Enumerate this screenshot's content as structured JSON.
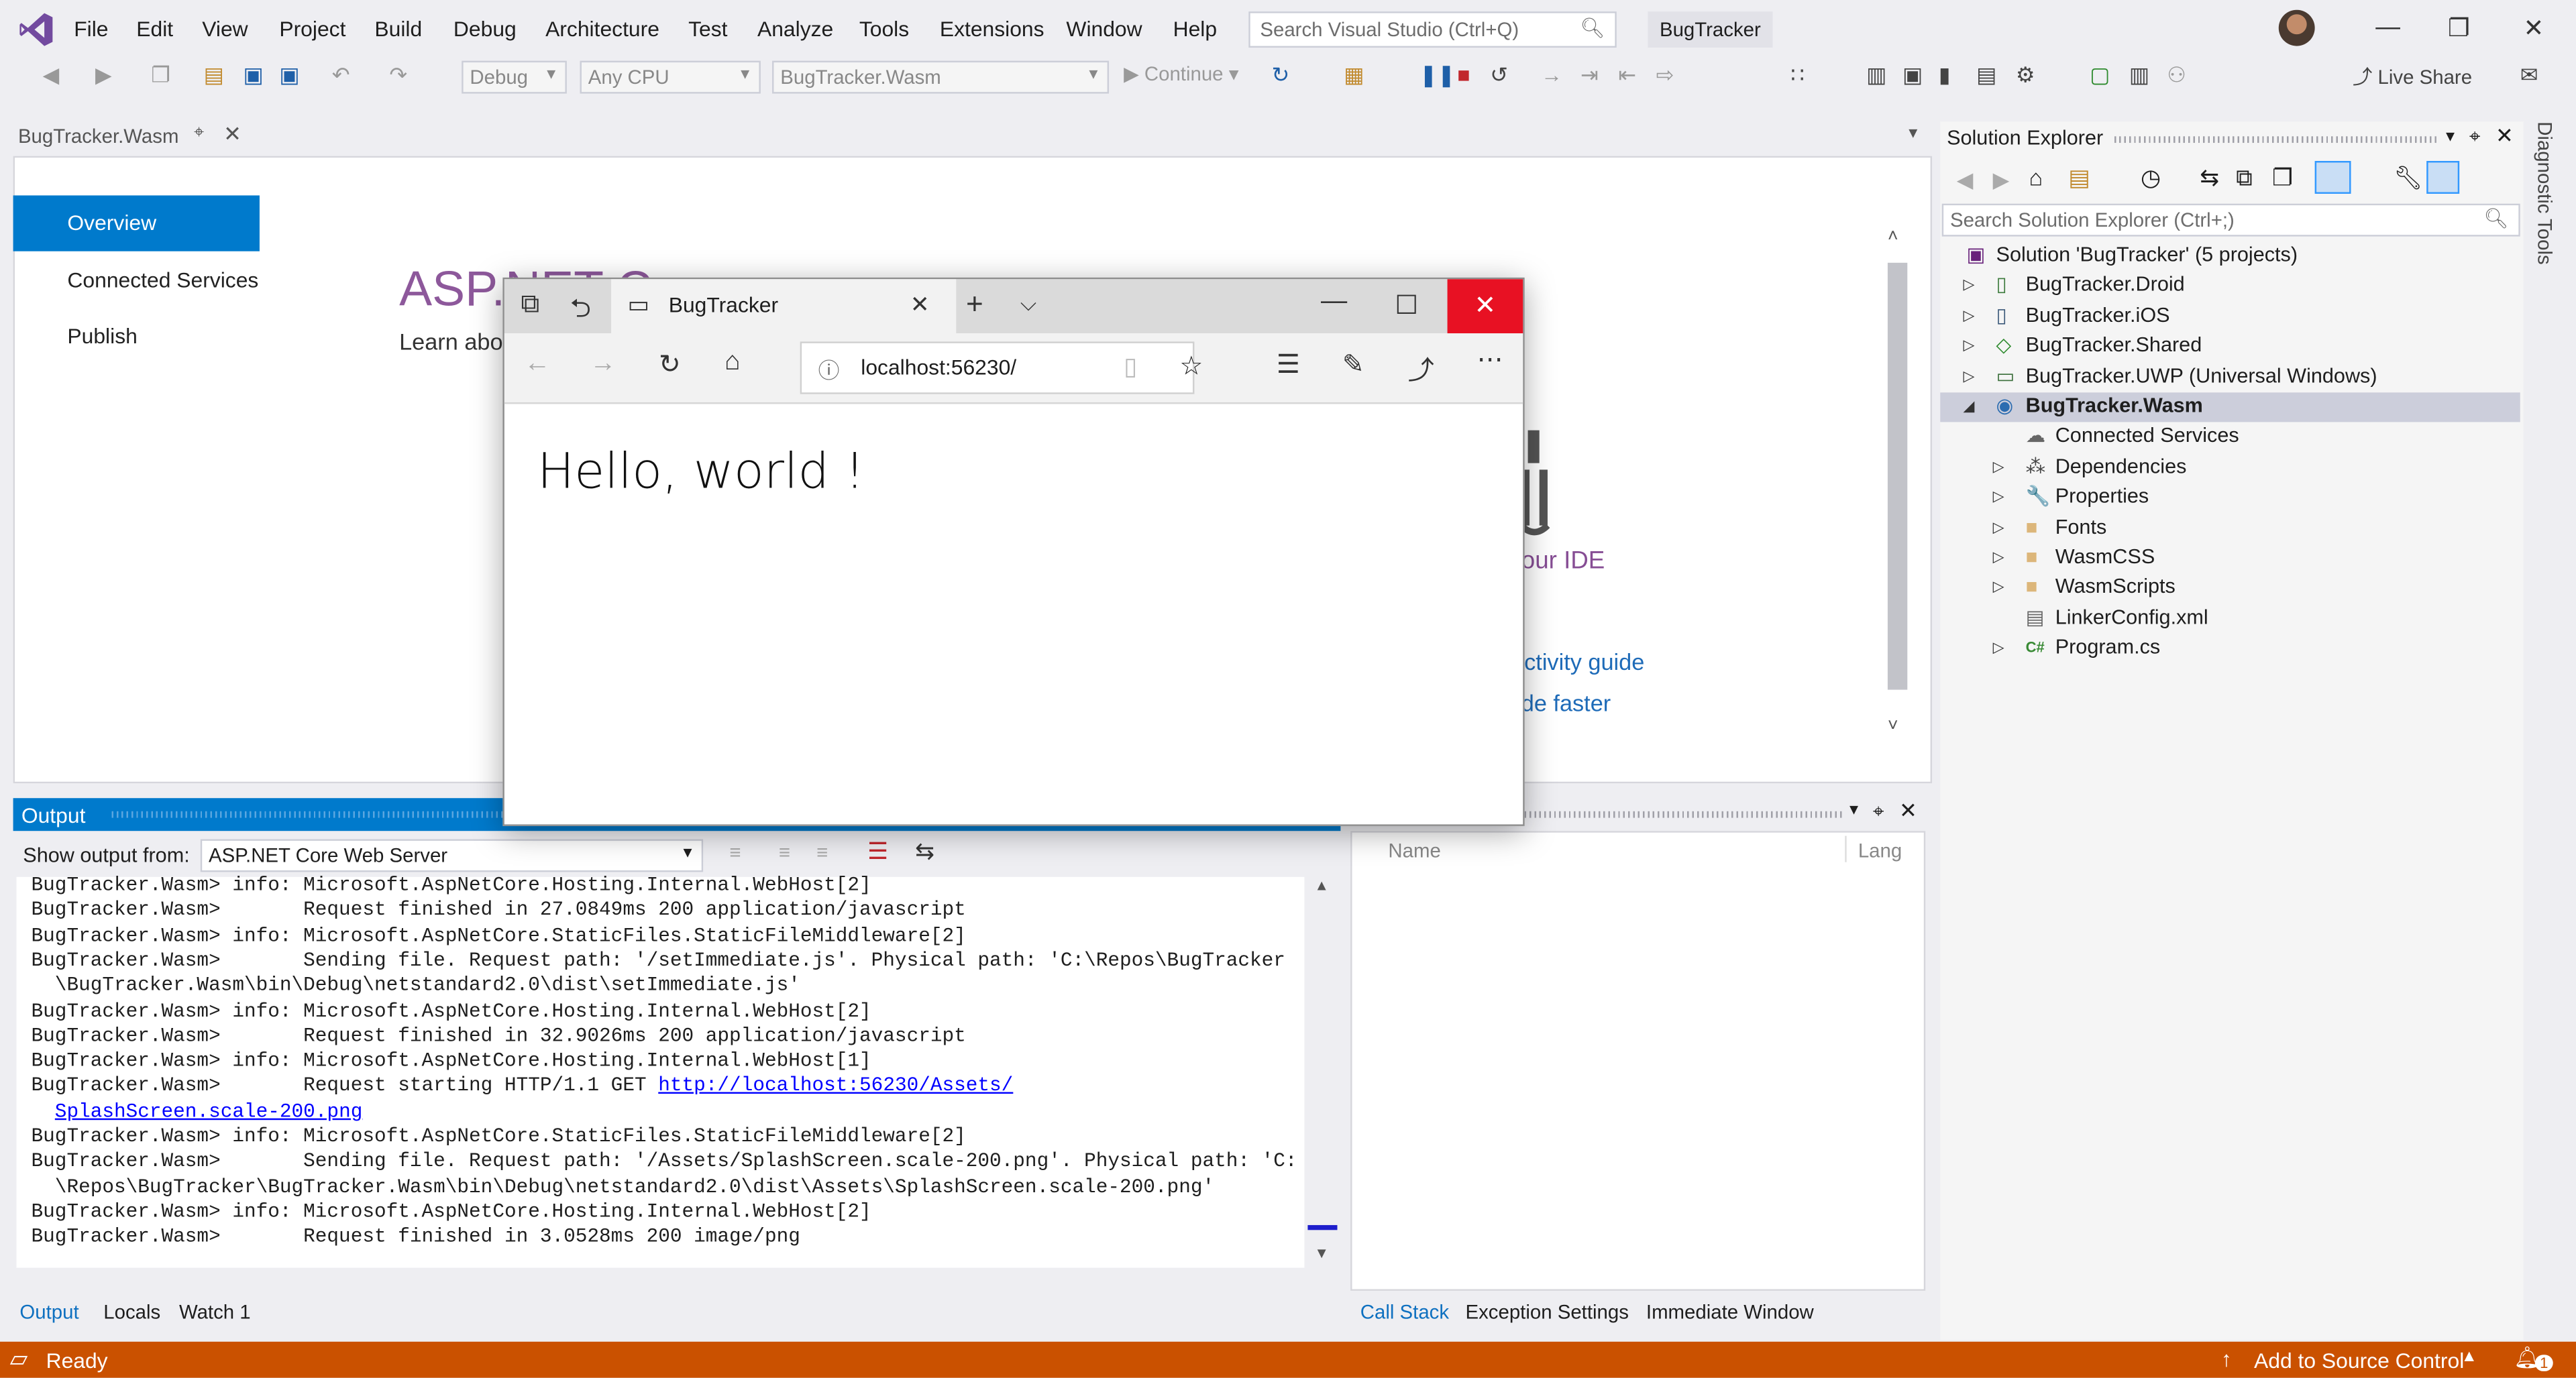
{
  "menubar": {
    "items": [
      "File",
      "Edit",
      "View",
      "Project",
      "Build",
      "Debug",
      "Architecture",
      "Test",
      "Analyze",
      "Tools",
      "Extensions",
      "Window",
      "Help"
    ],
    "search_placeholder": "Search Visual Studio (Ctrl+Q)",
    "solution_title": "BugTracker"
  },
  "toolbar": {
    "config": "Debug",
    "platform": "Any CPU",
    "startup_project": "BugTracker.Wasm",
    "continue_label": "Continue",
    "live_share_label": "Live Share"
  },
  "document": {
    "tab_title": "BugTracker.Wasm",
    "nav_items": [
      {
        "label": "Overview",
        "selected": true
      },
      {
        "label": "Connected Services",
        "selected": false
      },
      {
        "label": "Publish",
        "selected": false
      }
    ],
    "page_heading_partial": "ASP.NET C",
    "page_sub_partial": "Learn abo",
    "right_text_1": "our IDE",
    "right_link_1": "uctivity guide",
    "right_link_2": "de faster"
  },
  "browser": {
    "tab_title": "BugTracker",
    "url": "localhost:56230/",
    "content": "Hello, world !"
  },
  "output": {
    "title": "Output",
    "show_from_label": "Show output from:",
    "source": "ASP.NET Core Web Server",
    "lines": [
      {
        "text": "BugTracker.Wasm> info: Microsoft.AspNetCore.Hosting.Internal.WebHost[2]"
      },
      {
        "text": "BugTracker.Wasm>       Request finished in 27.0849ms 200 application/javascript"
      },
      {
        "text": "BugTracker.Wasm> info: Microsoft.AspNetCore.StaticFiles.StaticFileMiddleware[2]"
      },
      {
        "text": "BugTracker.Wasm>       Sending file. Request path: '/setImmediate.js'. Physical path: 'C:\\Repos\\BugTracker"
      },
      {
        "text": "  \\BugTracker.Wasm\\bin\\Debug\\netstandard2.0\\dist\\setImmediate.js'"
      },
      {
        "text": "BugTracker.Wasm> info: Microsoft.AspNetCore.Hosting.Internal.WebHost[2]"
      },
      {
        "text": "BugTracker.Wasm>       Request finished in 32.9026ms 200 application/javascript"
      },
      {
        "text": "BugTracker.Wasm> info: Microsoft.AspNetCore.Hosting.Internal.WebHost[1]"
      },
      {
        "text": "BugTracker.Wasm>       Request starting HTTP/1.1 GET ",
        "link": "http://localhost:56230/Assets/"
      },
      {
        "text": "  ",
        "link": "SplashScreen.scale-200.png"
      },
      {
        "text": "BugTracker.Wasm> info: Microsoft.AspNetCore.StaticFiles.StaticFileMiddleware[2]"
      },
      {
        "text": "BugTracker.Wasm>       Sending file. Request path: '/Assets/SplashScreen.scale-200.png'. Physical path: 'C:"
      },
      {
        "text": "  \\Repos\\BugTracker\\BugTracker.Wasm\\bin\\Debug\\netstandard2.0\\dist\\Assets\\SplashScreen.scale-200.png'"
      },
      {
        "text": "BugTracker.Wasm> info: Microsoft.AspNetCore.Hosting.Internal.WebHost[2]"
      },
      {
        "text": "BugTracker.Wasm>       Request finished in 3.0528ms 200 image/png"
      }
    ],
    "bottom_tabs": [
      {
        "label": "Output",
        "active": true
      },
      {
        "label": "Locals",
        "active": false
      },
      {
        "label": "Watch 1",
        "active": false
      }
    ]
  },
  "callstack": {
    "col_name": "Name",
    "col_lang": "Lang",
    "bottom_tabs": [
      {
        "label": "Call Stack",
        "active": true
      },
      {
        "label": "Exception Settings",
        "active": false
      },
      {
        "label": "Immediate Window",
        "active": false
      }
    ]
  },
  "solution_explorer": {
    "title": "Solution Explorer",
    "search_placeholder": "Search Solution Explorer (Ctrl+;)",
    "items": [
      {
        "label": "Solution 'BugTracker' (5 projects)",
        "depth": 0,
        "expander": "",
        "icon": "solution-icon",
        "glyph": "▣",
        "color": "#68217a",
        "bold": false
      },
      {
        "label": "BugTracker.Droid",
        "depth": 1,
        "expander": "▷",
        "icon": "android-project-icon",
        "glyph": "▯",
        "color": "#3c7a3c",
        "bold": false
      },
      {
        "label": "BugTracker.iOS",
        "depth": 1,
        "expander": "▷",
        "icon": "ios-project-icon",
        "glyph": "▯",
        "color": "#3c5a7a",
        "bold": false
      },
      {
        "label": "BugTracker.Shared",
        "depth": 1,
        "expander": "▷",
        "icon": "shared-project-icon",
        "glyph": "◇",
        "color": "#2d8a2d",
        "bold": false
      },
      {
        "label": "BugTracker.UWP (Universal Windows)",
        "depth": 1,
        "expander": "▷",
        "icon": "csharp-project-icon",
        "glyph": "▭",
        "color": "#3a6e3a",
        "bold": false
      },
      {
        "label": "BugTracker.Wasm",
        "depth": 1,
        "expander": "◢",
        "icon": "web-project-icon",
        "glyph": "◉",
        "color": "#2b6cb0",
        "bold": true
      },
      {
        "label": "Connected Services",
        "depth": 2,
        "expander": "",
        "icon": "cloud-icon",
        "glyph": "☁",
        "color": "#666666",
        "bold": false
      },
      {
        "label": "Dependencies",
        "depth": 2,
        "expander": "▷",
        "icon": "dependencies-icon",
        "glyph": "⁂",
        "color": "#444444",
        "bold": false
      },
      {
        "label": "Properties",
        "depth": 2,
        "expander": "▷",
        "icon": "wrench-icon",
        "glyph": "🔧",
        "color": "#444444",
        "bold": false
      },
      {
        "label": "Fonts",
        "depth": 2,
        "expander": "▷",
        "icon": "folder-icon",
        "glyph": "■",
        "color": "#dcb67a",
        "bold": false
      },
      {
        "label": "WasmCSS",
        "depth": 2,
        "expander": "▷",
        "icon": "folder-icon",
        "glyph": "■",
        "color": "#dcb67a",
        "bold": false
      },
      {
        "label": "WasmScripts",
        "depth": 2,
        "expander": "▷",
        "icon": "folder-icon",
        "glyph": "■",
        "color": "#dcb67a",
        "bold": false
      },
      {
        "label": "LinkerConfig.xml",
        "depth": 2,
        "expander": "",
        "icon": "xml-file-icon",
        "glyph": "▤",
        "color": "#666666",
        "bold": false
      },
      {
        "label": "Program.cs",
        "depth": 2,
        "expander": "▷",
        "icon": "csharp-file-icon",
        "glyph": "C#",
        "color": "#388a34",
        "bold": false
      }
    ]
  },
  "side_tool": {
    "label": "Diagnostic Tools"
  },
  "statusbar": {
    "ready": "Ready",
    "source_control": "Add to Source Control",
    "notification_count": "1",
    "color": "#ca5100"
  }
}
